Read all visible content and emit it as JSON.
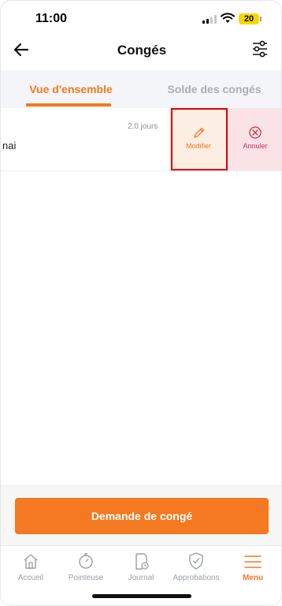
{
  "status_bar": {
    "time": "11:00",
    "battery": "20"
  },
  "header": {
    "title": "Congés"
  },
  "tabs": [
    {
      "label": "Vue d'ensemble",
      "active": true
    },
    {
      "label": "Solde des congés",
      "active": false
    }
  ],
  "leave_row": {
    "duration": "2.0 jours",
    "text": "nai",
    "actions": {
      "edit_label": "Modifier",
      "cancel_label": "Annuler"
    }
  },
  "request_button": {
    "label": "Demande de congé"
  },
  "bottom_nav": [
    {
      "label": "Accueil",
      "icon": "home-icon",
      "active": false
    },
    {
      "label": "Pointeuse",
      "icon": "stopwatch-icon",
      "active": false
    },
    {
      "label": "Journal",
      "icon": "journal-icon",
      "active": false
    },
    {
      "label": "Approbations",
      "icon": "shield-check-icon",
      "active": false
    },
    {
      "label": "Menu",
      "icon": "menu-icon",
      "active": true
    }
  ],
  "colors": {
    "accent": "#f47920",
    "cancel": "#c8324a",
    "highlight_outline": "#e00000"
  }
}
